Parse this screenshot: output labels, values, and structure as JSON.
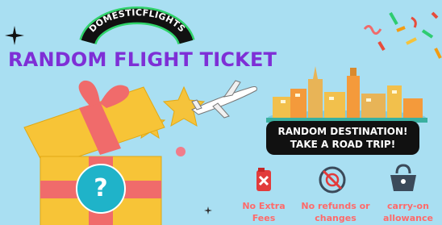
{
  "brand": {
    "arc_text": "DOMESTICFLIGHTS"
  },
  "title": "RANDOM FLIGHT TICKET",
  "destination": {
    "line1": "RANDOM DESTINATION!",
    "line2": "TAKE A ROAD TRIP!"
  },
  "gift": {
    "question_mark": "?"
  },
  "features": [
    {
      "line1": "No Extra",
      "line2": "Fees",
      "icon": "fuel-can-x-icon"
    },
    {
      "line1": "No refunds or",
      "line2": "changes",
      "icon": "no-refund-icon"
    },
    {
      "line1": "carry-on",
      "line2": "allowance",
      "icon": "handbag-icon"
    }
  ],
  "colors": {
    "background": "#a9dff2",
    "title": "#7e2fd6",
    "arc_band": "#111111",
    "arc_text": "#ffffff",
    "gift_box": "#f7c437",
    "ribbon": "#f06b6b",
    "star": "#f5c33b",
    "feature_text": "#ff6a6a",
    "destination_bg": "#111111"
  }
}
